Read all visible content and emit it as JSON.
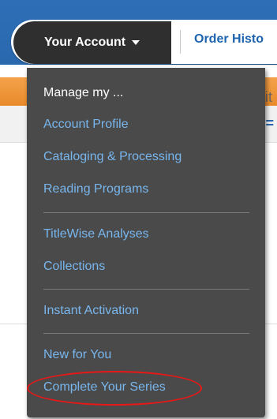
{
  "nav": {
    "account_label": "Your Account",
    "order_label": "Order Histo"
  },
  "background": {
    "fragment_1": "it",
    "fragment_2": "="
  },
  "menu": {
    "header": "Manage my ...",
    "items": [
      {
        "label": "Account Profile"
      },
      {
        "label": "Cataloging & Processing"
      },
      {
        "label": "Reading Programs"
      },
      {
        "label": "TitleWise Analyses"
      },
      {
        "label": "Collections"
      },
      {
        "label": "Instant Activation"
      },
      {
        "label": "New for You"
      },
      {
        "label": "Complete Your Series"
      }
    ]
  },
  "colors": {
    "link": "#78b6ee",
    "menu_bg": "#4a4a4a",
    "highlight": "#e81818",
    "nav_dark": "#2f2f2f",
    "header_blue": "#2a68ad"
  },
  "icons": {
    "account_caret": "caret-down-icon"
  }
}
